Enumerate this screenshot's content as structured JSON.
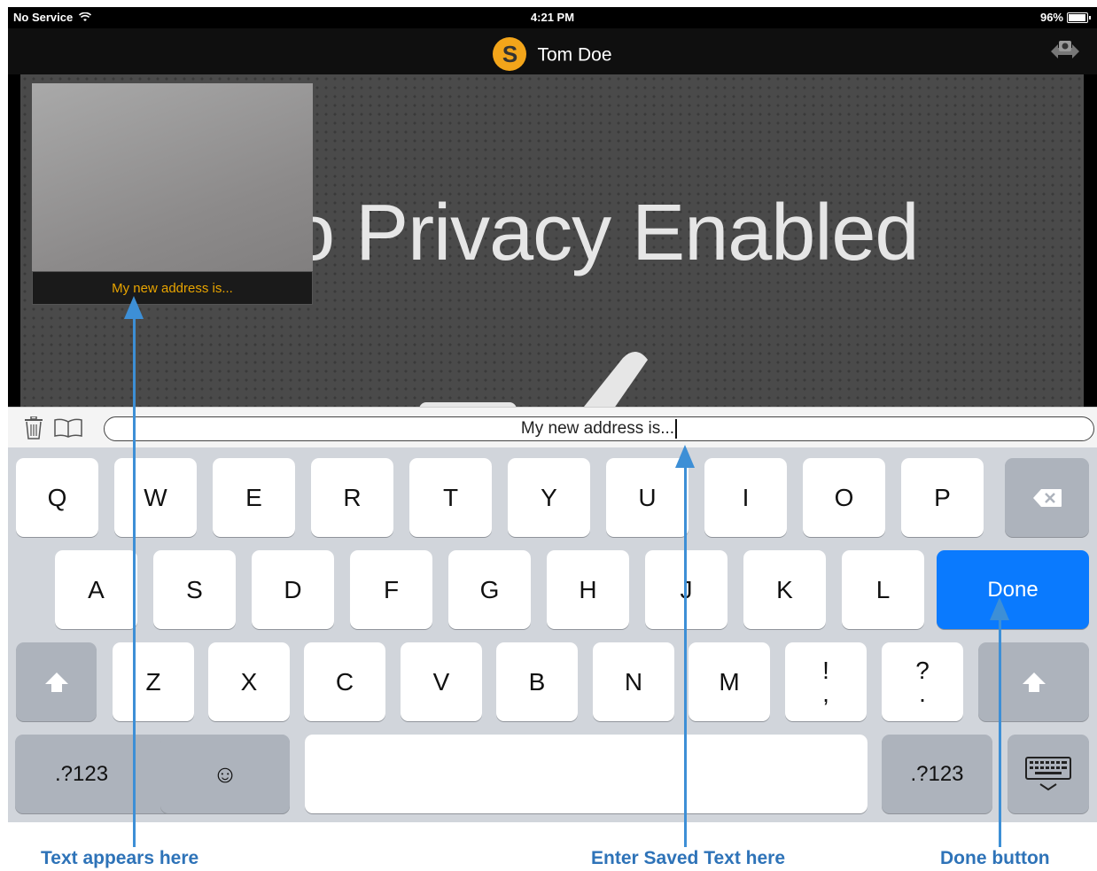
{
  "status_bar": {
    "carrier": "No Service",
    "time": "4:21 PM",
    "battery": "96%"
  },
  "nav": {
    "title": "Tom Doe",
    "logo_letter": "S",
    "camera_icon": "camera-switch-icon"
  },
  "video": {
    "privacy_text": "eo Privacy Enabled",
    "self_caption": "My new address is..."
  },
  "input": {
    "value": "My new address is...",
    "trash_icon": "trash-icon",
    "book_icon": "book-icon"
  },
  "keyboard": {
    "row1": [
      "Q",
      "W",
      "E",
      "R",
      "T",
      "Y",
      "U",
      "I",
      "O",
      "P"
    ],
    "row2": [
      "A",
      "S",
      "D",
      "F",
      "G",
      "H",
      "J",
      "K",
      "L"
    ],
    "row3": [
      "Z",
      "X",
      "C",
      "V",
      "B",
      "N",
      "M"
    ],
    "punct1": {
      "top": "!",
      "bottom": ","
    },
    "punct2": {
      "top": "?",
      "bottom": "."
    },
    "done_label": "Done",
    "numbers_label": ".?123",
    "emoji": "☺",
    "delete_icon": "delete-icon",
    "shift_icon": "shift-icon",
    "hide_keyboard_icon": "keyboard-hide-icon",
    "accent": "#0a7afe"
  },
  "callouts": {
    "text_appears": "Text appears here",
    "enter_text": "Enter Saved Text here",
    "done_button": "Done button",
    "color": "#3d8fd6"
  }
}
